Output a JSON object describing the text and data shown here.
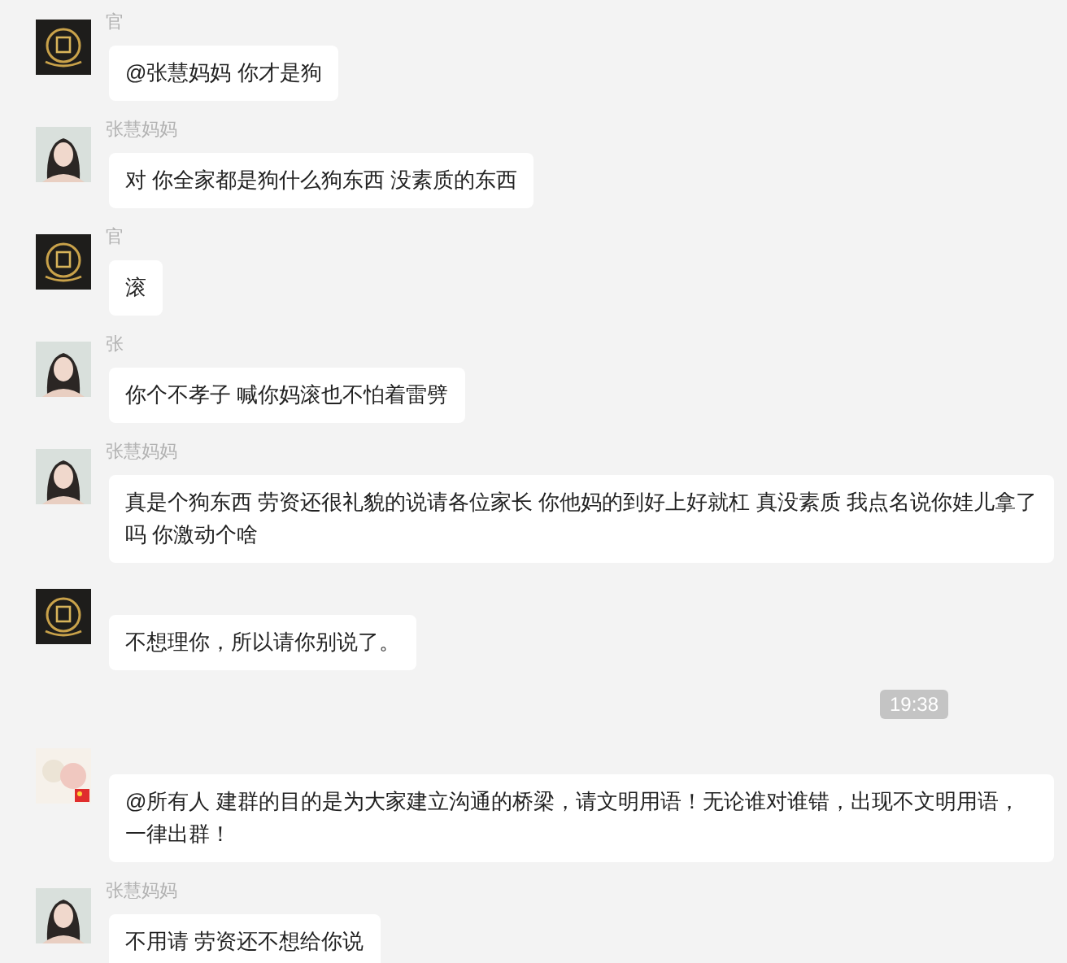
{
  "items": [
    {
      "kind": "message",
      "sender": "官",
      "avatar": {
        "kind": "logo"
      },
      "text": "@张慧妈妈 你才是狗"
    },
    {
      "kind": "message",
      "sender": "张慧妈妈",
      "avatar": {
        "kind": "person"
      },
      "text": "对 你全家都是狗什么狗东西 没素质的东西"
    },
    {
      "kind": "message",
      "sender": "官",
      "avatar": {
        "kind": "logo"
      },
      "text": "滚"
    },
    {
      "kind": "message",
      "sender": "张",
      "avatar": {
        "kind": "person"
      },
      "text": "你个不孝子  喊你妈滚也不怕着雷劈"
    },
    {
      "kind": "message",
      "sender": "张慧妈妈",
      "avatar": {
        "kind": "person"
      },
      "text": "真是个狗东西 劳资还很礼貌的说请各位家长 你他妈的到好上好就杠 真没素质 我点名说你娃儿拿了吗 你激动个啥"
    },
    {
      "kind": "message",
      "avatar": {
        "kind": "logo"
      },
      "text": "不想理你，所以请你别说了。"
    },
    {
      "kind": "time",
      "text": "19:38"
    },
    {
      "kind": "message",
      "avatar": {
        "kind": "illustration"
      },
      "text": "@所有人 建群的目的是为大家建立沟通的桥梁，请文明用语！无论谁对谁错，出现不文明用语，一律出群！"
    },
    {
      "kind": "message",
      "sender": "张慧妈妈",
      "avatar": {
        "kind": "person"
      },
      "text": "不用请  劳资还不想给你说"
    }
  ]
}
